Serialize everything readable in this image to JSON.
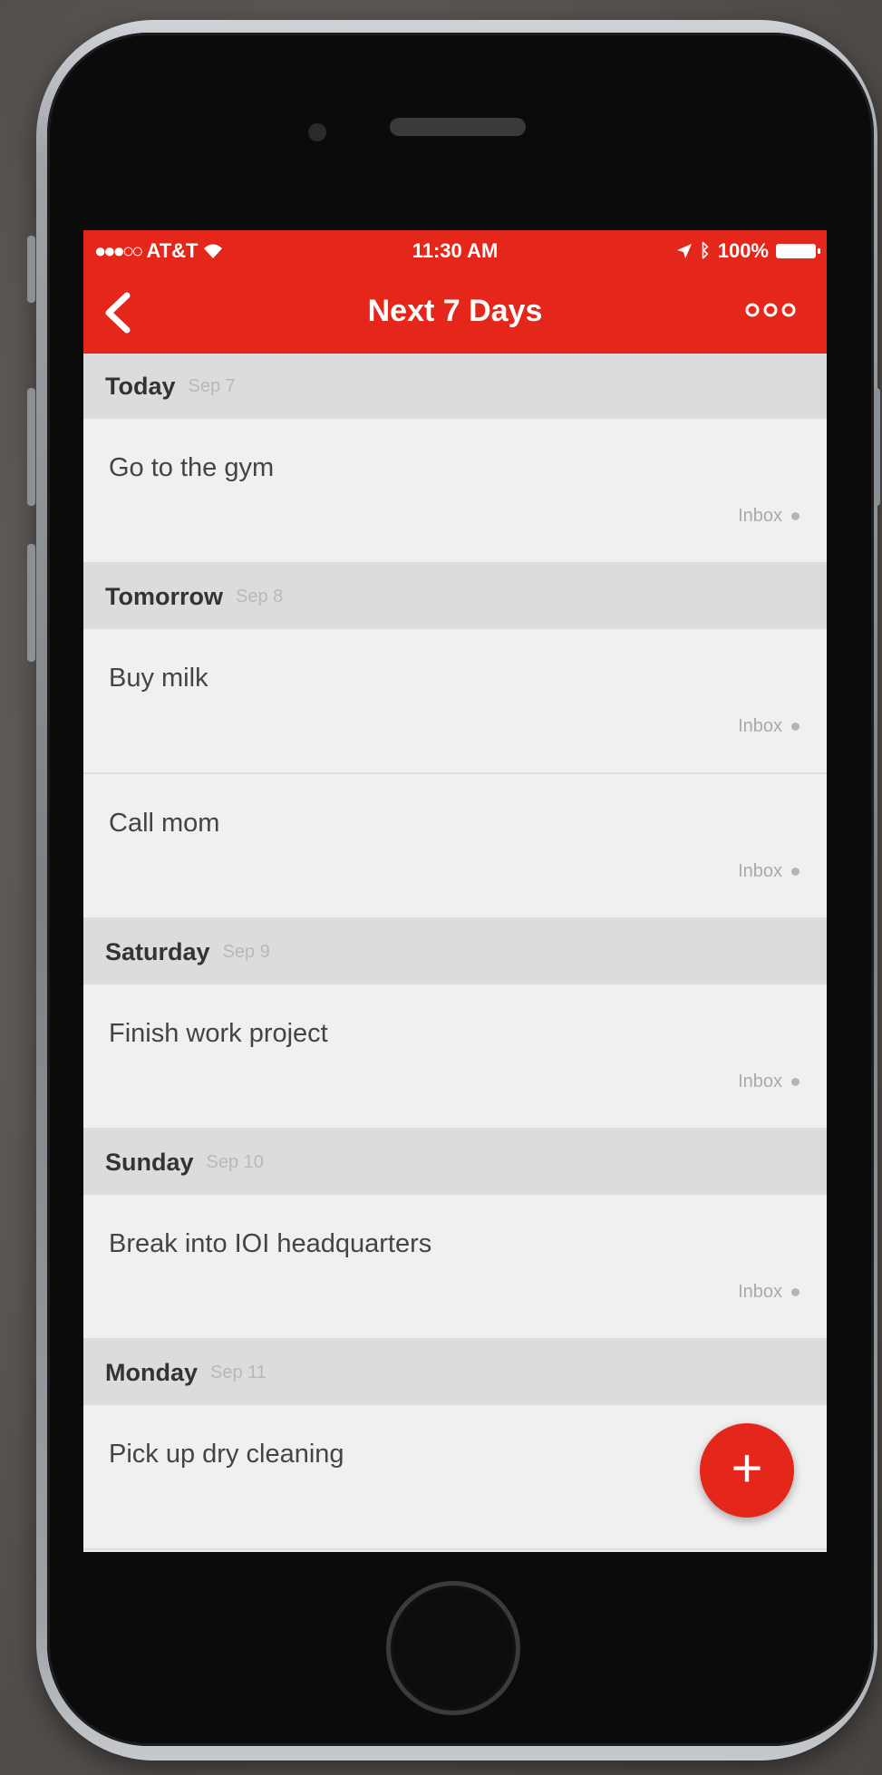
{
  "status": {
    "carrier": "AT&T",
    "time": "11:30 AM",
    "battery": "100%"
  },
  "nav": {
    "title": "Next 7 Days",
    "back_glyph": "‹",
    "more_glyph": "•••"
  },
  "sections": [
    {
      "name": "Today",
      "date": "Sep 7",
      "tasks": [
        {
          "title": "Go to the gym",
          "project": "Inbox"
        }
      ]
    },
    {
      "name": "Tomorrow",
      "date": "Sep 8",
      "tasks": [
        {
          "title": "Buy milk",
          "project": "Inbox"
        },
        {
          "title": "Call mom",
          "project": "Inbox"
        }
      ]
    },
    {
      "name": "Saturday",
      "date": "Sep 9",
      "tasks": [
        {
          "title": "Finish work project",
          "project": "Inbox"
        }
      ]
    },
    {
      "name": "Sunday",
      "date": "Sep 10",
      "tasks": [
        {
          "title": "Break into IOI headquarters",
          "project": "Inbox"
        }
      ]
    },
    {
      "name": "Monday",
      "date": "Sep 11",
      "tasks": [
        {
          "title": "Pick up dry cleaning",
          "project": ""
        }
      ]
    }
  ],
  "fab": {
    "glyph": "+"
  },
  "colors": {
    "accent": "#e4261b",
    "list_bg": "#f0f0f0",
    "header_bg": "#dcdcdc"
  }
}
